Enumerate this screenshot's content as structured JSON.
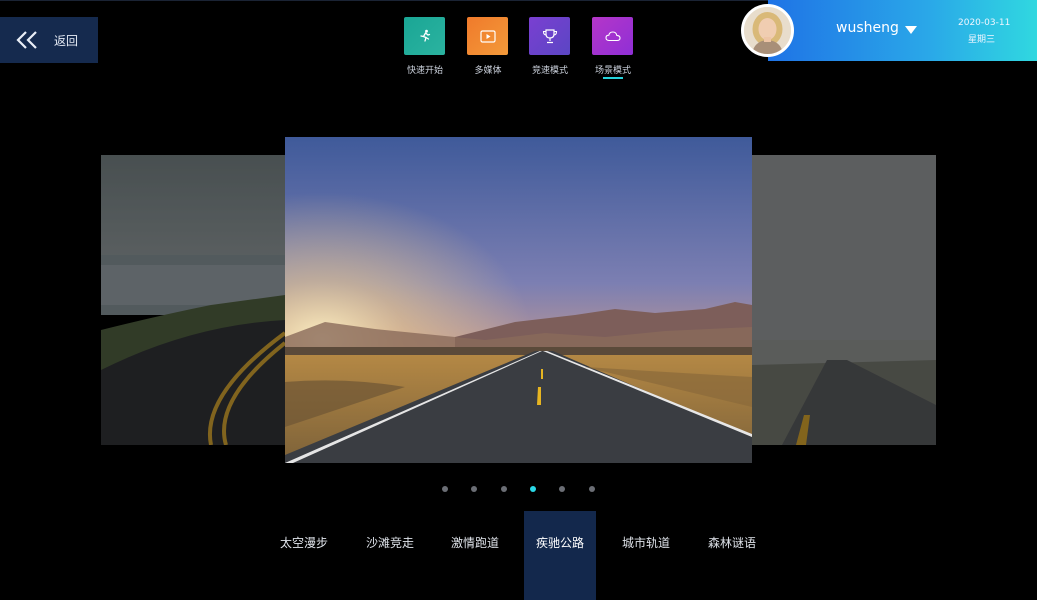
{
  "back": {
    "label": "返回"
  },
  "modes": [
    {
      "label": "快速开始",
      "icon": "running-icon",
      "color_from": "#1aa695",
      "color_to": "#2bb3a0"
    },
    {
      "label": "多媒体",
      "icon": "video-icon",
      "color_from": "#f07a2b",
      "color_to": "#f39a3a"
    },
    {
      "label": "竞速模式",
      "icon": "trophy-icon",
      "color_from": "#7a3fd1",
      "color_to": "#5b46c4"
    },
    {
      "label": "场景模式",
      "icon": "cloud-icon",
      "color_from": "#b536c8",
      "color_to": "#8f2fd6"
    }
  ],
  "active_mode": "场景模式",
  "user": {
    "name": "wusheng",
    "date": "2020-03-11",
    "weekday": "星期三"
  },
  "carousel": {
    "slide_count": 6,
    "active_index": 3
  },
  "scenes": [
    "太空漫步",
    "沙滩竞走",
    "激情跑道",
    "疾驰公路",
    "城市轨道",
    "森林谜语"
  ],
  "active_scene": "疾驰公路",
  "colors": {
    "accent": "#2ad8e6",
    "panel": "#13284c",
    "back_button": "#152a4e"
  }
}
